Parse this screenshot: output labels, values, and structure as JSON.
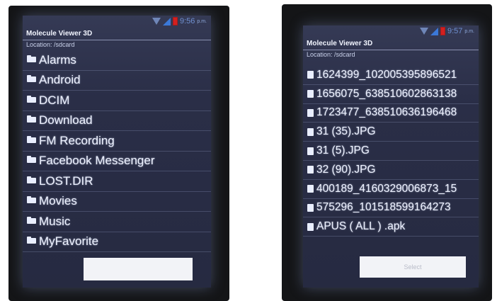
{
  "left": {
    "status": {
      "time": "9:56",
      "ampm": "p.m."
    },
    "app_title": "Molecule Viewer 3D",
    "location": "Location: /sdcard",
    "items": [
      {
        "name": "Alarms"
      },
      {
        "name": "Android"
      },
      {
        "name": "DCIM"
      },
      {
        "name": "Download"
      },
      {
        "name": "FM Recording"
      },
      {
        "name": "Facebook Messenger"
      },
      {
        "name": "LOST.DIR"
      },
      {
        "name": "Movies"
      },
      {
        "name": "Music"
      },
      {
        "name": "MyFavorite"
      }
    ],
    "select_button": {
      "label": ""
    }
  },
  "right": {
    "status": {
      "time": "9:57",
      "ampm": "p.m."
    },
    "app_title": "Molecule Viewer 3D",
    "location": "Location: /sdcard",
    "items": [
      {
        "name": "1624399_102005395896521"
      },
      {
        "name": "1656075_638510602863138"
      },
      {
        "name": "1723477_638510636196468"
      },
      {
        "name": "31 (35).JPG"
      },
      {
        "name": "31 (5).JPG"
      },
      {
        "name": "32 (90).JPG"
      },
      {
        "name": "400189_4160329006873_15"
      },
      {
        "name": "575296_101518599164273"
      },
      {
        "name": "APUS ( ALL ) .apk"
      }
    ],
    "select_button": {
      "label": "Select"
    }
  },
  "colors": {
    "screen_bg": "#2a2e47",
    "text": "#eef2ff",
    "battery": "#d32020",
    "signal": "#3b78d8"
  }
}
